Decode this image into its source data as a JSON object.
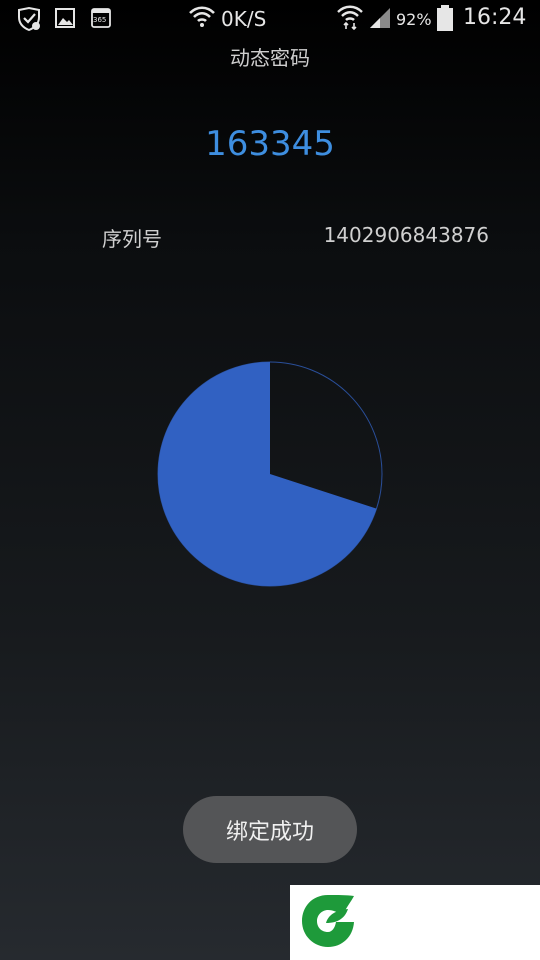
{
  "status_bar": {
    "net_speed": "0K/S",
    "battery_pct": "92%",
    "time": "16:24",
    "calendar_day": "365",
    "icons": [
      "shield-check-icon",
      "gallery-icon",
      "calendar-icon",
      "wifi-icon",
      "wifi-transfer-icon",
      "signal-icon",
      "battery-icon"
    ]
  },
  "screen": {
    "title": "动态密码",
    "otp_code": "163345",
    "serial_label": "序列号",
    "serial_value": "1402906843876"
  },
  "timer": {
    "remaining_fraction": 0.7,
    "colors": {
      "fill": "#3161c2",
      "outline": "#2a4f9a"
    }
  },
  "toast": {
    "message": "绑定成功"
  },
  "watermark": {
    "icon": "leaf-logo-icon",
    "color": "#1e9a3a"
  }
}
